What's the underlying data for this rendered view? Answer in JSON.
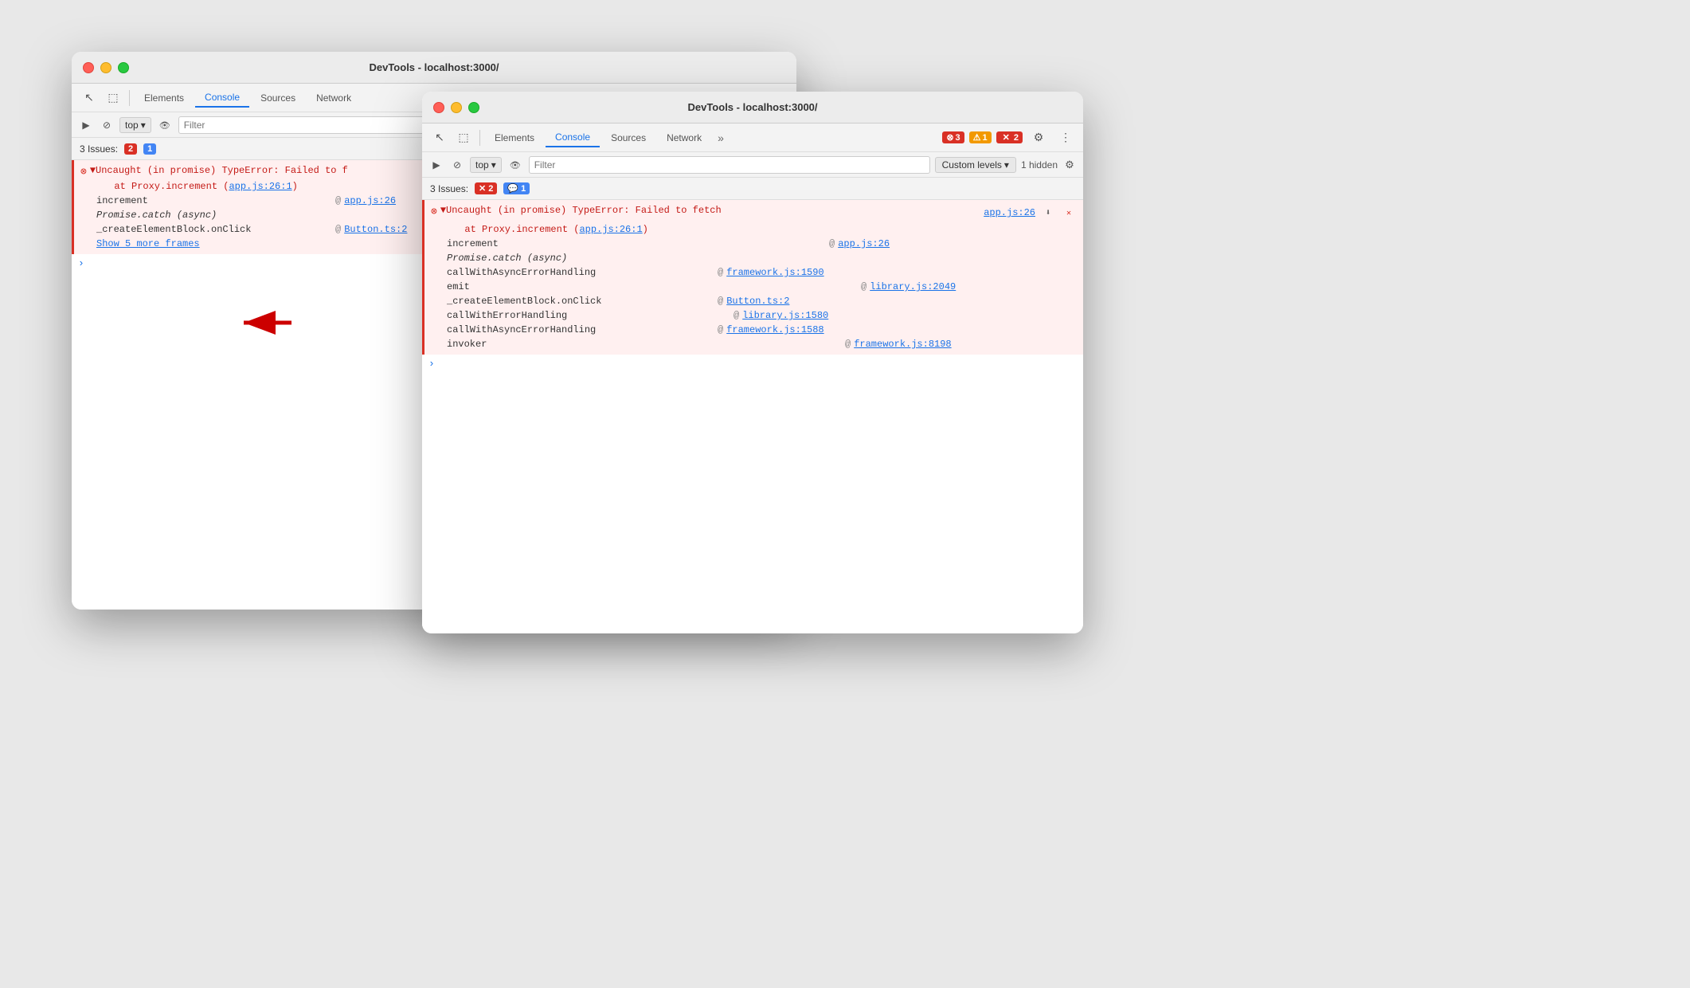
{
  "window1": {
    "title": "DevTools - localhost:3000/",
    "tabs": [
      "Elements",
      "Console",
      "Sources",
      "Network"
    ],
    "active_tab": "Console",
    "toolbar": {
      "top_label": "top",
      "filter_placeholder": "Filter"
    },
    "issues": {
      "label": "3 Issues:",
      "error_count": "2",
      "msg_count": "1"
    },
    "error": {
      "main": "▼Uncaught (in promise) TypeError: Failed to f",
      "proxy": "at Proxy.increment (",
      "proxy_link": "app.js:26:1",
      "close_paren": ")"
    },
    "stack": [
      {
        "fn": "increment",
        "at": "@",
        "link": "app.js:26"
      },
      {
        "fn": "Promise.catch (async)",
        "at": "",
        "link": ""
      },
      {
        "fn": "_createElementBlock.onClick",
        "at": "@",
        "link": "Button.ts:2"
      }
    ],
    "show_more": "Show 5 more frames"
  },
  "window2": {
    "title": "DevTools - localhost:3000/",
    "tabs": [
      "Elements",
      "Console",
      "Sources",
      "Network"
    ],
    "active_tab": "Console",
    "toolbar": {
      "top_label": "top",
      "filter_placeholder": "Filter",
      "custom_levels": "Custom levels",
      "hidden_count": "1 hidden"
    },
    "badge_counts": {
      "error": "3",
      "warn": "1",
      "blue": "2"
    },
    "issues": {
      "label": "3 Issues:",
      "error_count": "2",
      "msg_count": "1"
    },
    "error": {
      "main": "▼Uncaught (in promise) TypeError: Failed to fetch",
      "proxy": "at Proxy.increment (",
      "proxy_link": "app.js:26:1",
      "close_paren": ")",
      "side_link": "app.js:26"
    },
    "stack": [
      {
        "fn": "increment",
        "at": "@",
        "link": "app.js:26",
        "italic": false
      },
      {
        "fn": "Promise.catch (async)",
        "at": "",
        "link": "",
        "italic": true
      },
      {
        "fn": "callWithAsyncErrorHandling",
        "at": "@",
        "link": "framework.js:1590",
        "italic": false
      },
      {
        "fn": "emit",
        "at": "@",
        "link": "library.js:2049",
        "italic": false
      },
      {
        "fn": "_createElementBlock.onClick",
        "at": "@",
        "link": "Button.ts:2",
        "italic": false
      },
      {
        "fn": "callWithErrorHandling",
        "at": "@",
        "link": "library.js:1580",
        "italic": false
      },
      {
        "fn": "callWithAsyncErrorHandling",
        "at": "@",
        "link": "framework.js:1588",
        "italic": false
      },
      {
        "fn": "invoker",
        "at": "@",
        "link": "framework.js:8198",
        "italic": false
      }
    ]
  },
  "arrow": {
    "label": "→ red arrow pointing left"
  }
}
